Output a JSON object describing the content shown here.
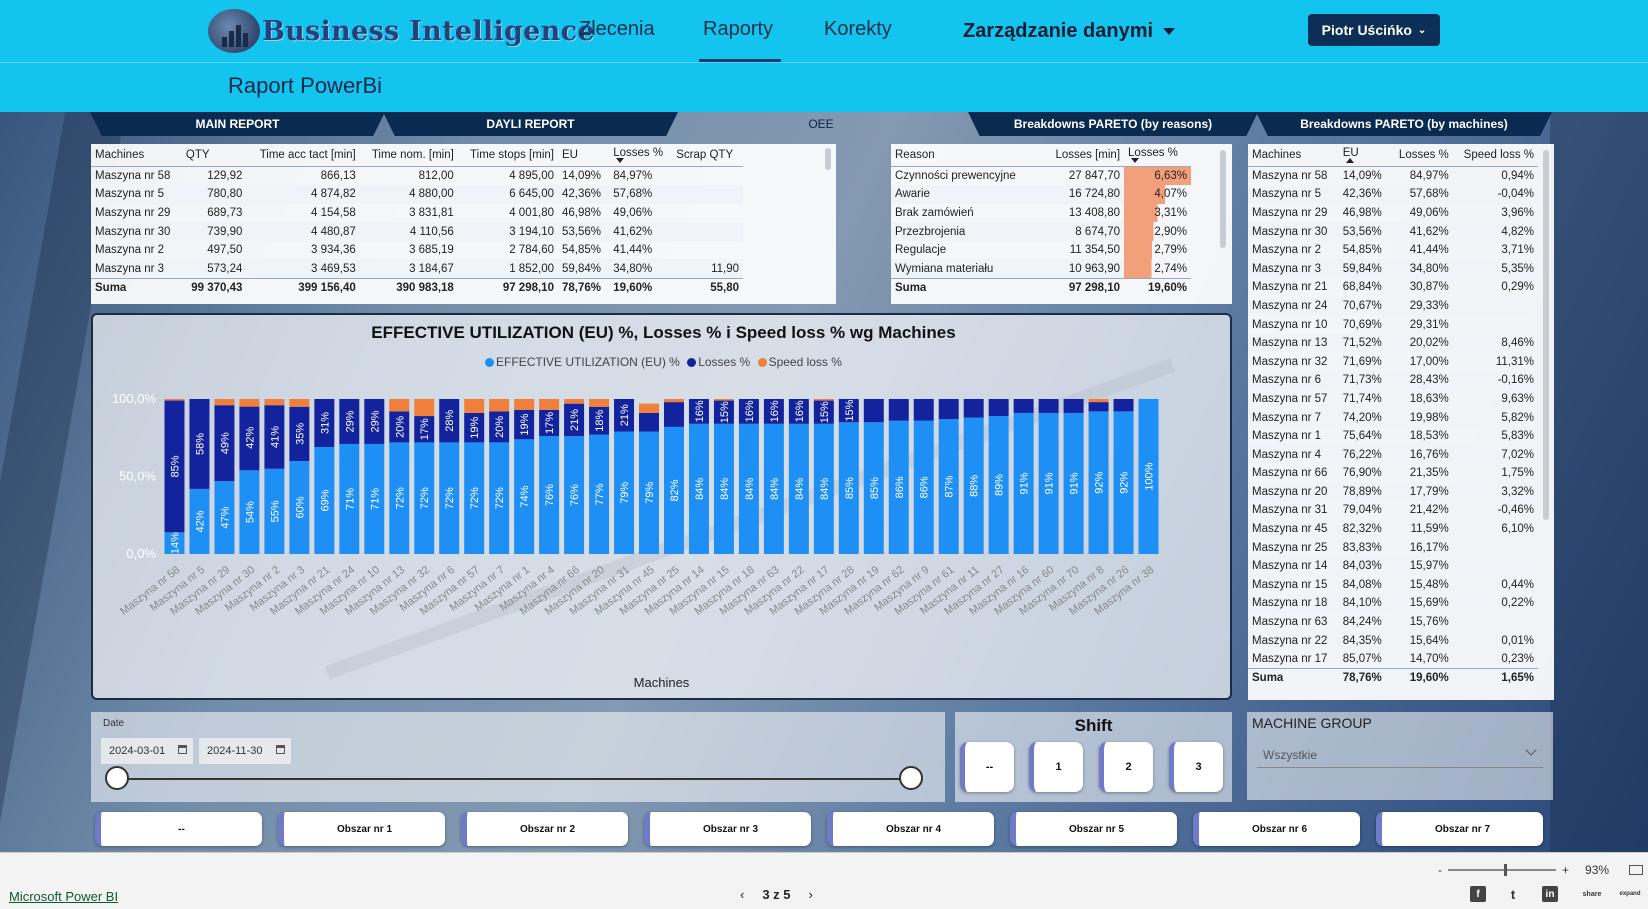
{
  "app": {
    "logo_text": "Business Intelligence",
    "nav": [
      "Zlecenia",
      "Raporty",
      "Korekty"
    ],
    "nav_active": "Raporty",
    "data_menu": "Zarządzanie danymi",
    "user": "Piotr Uścińko"
  },
  "page_title": "Raport PowerBi",
  "tabs": [
    "MAIN REPORT",
    "DAYLI REPORT",
    "OEE",
    "Breakdowns PARETO (by reasons)",
    "Breakdowns PARETO (by machines)"
  ],
  "main_table": {
    "headers": [
      "Machines",
      "QTY",
      "Time acc tact [min]",
      "Time nom. [min]",
      "Time stops [min]",
      "EU",
      "Losses %",
      "Scrap QTY"
    ],
    "rows": [
      [
        "Maszyna nr 58",
        "129,92",
        "866,13",
        "812,00",
        "4 895,00",
        "14,09%",
        "84,97%",
        ""
      ],
      [
        "Maszyna nr 5",
        "780,80",
        "4 874,82",
        "4 880,00",
        "6 645,00",
        "42,36%",
        "57,68%",
        ""
      ],
      [
        "Maszyna nr 29",
        "689,73",
        "4 154,58",
        "3 831,81",
        "4 001,80",
        "46,98%",
        "49,06%",
        ""
      ],
      [
        "Maszyna nr 30",
        "739,90",
        "4 480,87",
        "4 110,56",
        "3 194,10",
        "53,56%",
        "41,62%",
        ""
      ],
      [
        "Maszyna nr 2",
        "497,50",
        "3 934,36",
        "3 685,19",
        "2 784,60",
        "54,85%",
        "41,44%",
        ""
      ],
      [
        "Maszyna nr 3",
        "573,24",
        "3 469,53",
        "3 184,67",
        "1 852,00",
        "59,84%",
        "34,80%",
        "11,90"
      ]
    ],
    "sum": [
      "Suma",
      "99 370,43",
      "399 156,40",
      "390 983,18",
      "97 298,10",
      "78,76%",
      "19,60%",
      "55,80"
    ]
  },
  "reason_table": {
    "headers": [
      "Reason",
      "Losses [min]",
      "Losses %"
    ],
    "rows": [
      [
        "Czynności prewencyjne",
        "27 847,70",
        "6,63%"
      ],
      [
        "Awarie",
        "16 724,80",
        "4,07%"
      ],
      [
        "Brak zamówień",
        "13 408,80",
        "3,31%"
      ],
      [
        "Przezbrojenia",
        "8 674,70",
        "2,90%"
      ],
      [
        "Regulacje",
        "11 354,50",
        "2,79%"
      ],
      [
        "Wymiana materiału",
        "10 963,90",
        "2,74%"
      ]
    ],
    "bar_values": [
      6.63,
      4.07,
      3.31,
      2.9,
      2.79,
      2.74
    ],
    "sum": [
      "Suma",
      "97 298,10",
      "19,60%"
    ]
  },
  "machine_table": {
    "headers": [
      "Machines",
      "EU",
      "Losses %",
      "Speed loss %"
    ],
    "rows": [
      [
        "Maszyna nr 58",
        "14,09%",
        "84,97%",
        "0,94%"
      ],
      [
        "Maszyna nr 5",
        "42,36%",
        "57,68%",
        "-0,04%"
      ],
      [
        "Maszyna nr 29",
        "46,98%",
        "49,06%",
        "3,96%"
      ],
      [
        "Maszyna nr 30",
        "53,56%",
        "41,62%",
        "4,82%"
      ],
      [
        "Maszyna nr 2",
        "54,85%",
        "41,44%",
        "3,71%"
      ],
      [
        "Maszyna nr 3",
        "59,84%",
        "34,80%",
        "5,35%"
      ],
      [
        "Maszyna nr 21",
        "68,84%",
        "30,87%",
        "0,29%"
      ],
      [
        "Maszyna nr 24",
        "70,67%",
        "29,33%",
        ""
      ],
      [
        "Maszyna nr 10",
        "70,69%",
        "29,31%",
        ""
      ],
      [
        "Maszyna nr 13",
        "71,52%",
        "20,02%",
        "8,46%"
      ],
      [
        "Maszyna nr 32",
        "71,69%",
        "17,00%",
        "11,31%"
      ],
      [
        "Maszyna nr 6",
        "71,73%",
        "28,43%",
        "-0,16%"
      ],
      [
        "Maszyna nr 57",
        "71,74%",
        "18,63%",
        "9,63%"
      ],
      [
        "Maszyna nr 7",
        "74,20%",
        "19,98%",
        "5,82%"
      ],
      [
        "Maszyna nr 1",
        "75,64%",
        "18,53%",
        "5,83%"
      ],
      [
        "Maszyna nr 4",
        "76,22%",
        "16,76%",
        "7,02%"
      ],
      [
        "Maszyna nr 66",
        "76,90%",
        "21,35%",
        "1,75%"
      ],
      [
        "Maszyna nr 20",
        "78,89%",
        "17,79%",
        "3,32%"
      ],
      [
        "Maszyna nr 31",
        "79,04%",
        "21,42%",
        "-0,46%"
      ],
      [
        "Maszyna nr 45",
        "82,32%",
        "11,59%",
        "6,10%"
      ],
      [
        "Maszyna nr 25",
        "83,83%",
        "16,17%",
        ""
      ],
      [
        "Maszyna nr 14",
        "84,03%",
        "15,97%",
        ""
      ],
      [
        "Maszyna nr 15",
        "84,08%",
        "15,48%",
        "0,44%"
      ],
      [
        "Maszyna nr 18",
        "84,10%",
        "15,69%",
        "0,22%"
      ],
      [
        "Maszyna nr 63",
        "84,24%",
        "15,76%",
        ""
      ],
      [
        "Maszyna nr 22",
        "84,35%",
        "15,64%",
        "0,01%"
      ],
      [
        "Maszyna nr 17",
        "85,07%",
        "14,70%",
        "0,23%"
      ]
    ],
    "sum": [
      "Suma",
      "78,76%",
      "19,60%",
      "1,65%"
    ]
  },
  "chart_data": {
    "type": "bar",
    "stacked": true,
    "title": "EFFECTIVE UTILIZATION (EU) %, Losses % i Speed loss % wg Machines",
    "xlabel": "Machines",
    "ylabel": "",
    "ylim": [
      0,
      100
    ],
    "yticks": [
      "0,0%",
      "50,0%",
      "100,0%"
    ],
    "legend_position": "top",
    "categories": [
      "Maszyna nr 58",
      "Maszyna nr 5",
      "Maszyna nr 29",
      "Maszyna nr 30",
      "Maszyna nr 2",
      "Maszyna nr 3",
      "Maszyna nr 21",
      "Maszyna nr 24",
      "Maszyna nr 10",
      "Maszyna nr 13",
      "Maszyna nr 32",
      "Maszyna nr 6",
      "Maszyna nr 57",
      "Maszyna nr 7",
      "Maszyna nr 1",
      "Maszyna nr 4",
      "Maszyna nr 66",
      "Maszyna nr 20",
      "Maszyna nr 31",
      "Maszyna nr 45",
      "Maszyna nr 25",
      "Maszyna nr 14",
      "Maszyna nr 15",
      "Maszyna nr 18",
      "Maszyna nr 63",
      "Maszyna nr 22",
      "Maszyna nr 17",
      "Maszyna nr 28",
      "Maszyna nr 19",
      "Maszyna nr 62",
      "Maszyna nr 9",
      "Maszyna nr 61",
      "Maszyna nr 11",
      "Maszyna nr 27",
      "Maszyna nr 16",
      "Maszyna nr 60",
      "Maszyna nr 70",
      "Maszyna nr 8",
      "Maszyna nr 26",
      "Maszyna nr 38"
    ],
    "series": [
      {
        "name": "EFFECTIVE UTILIZATION (EU) %",
        "color": "#1e8ff5",
        "values": [
          14,
          42,
          47,
          54,
          55,
          60,
          69,
          71,
          71,
          72,
          72,
          72,
          72,
          72,
          74,
          76,
          76,
          77,
          79,
          79,
          82,
          84,
          84,
          84,
          84,
          84,
          84,
          85,
          85,
          86,
          86,
          87,
          88,
          89,
          91,
          91,
          91,
          92,
          92,
          100
        ]
      },
      {
        "name": "Losses %",
        "color": "#13239e",
        "values": [
          85,
          58,
          49,
          42,
          41,
          35,
          31,
          29,
          29,
          20,
          17,
          28,
          19,
          20,
          19,
          17,
          21,
          18,
          21,
          12,
          16,
          16,
          15,
          16,
          16,
          16,
          15,
          15,
          15,
          14,
          14,
          13,
          12,
          11,
          9,
          9,
          9,
          6,
          8,
          0
        ]
      },
      {
        "name": "Speed loss %",
        "color": "#ef7f3a",
        "values": [
          1,
          0,
          4,
          5,
          4,
          5,
          0,
          0,
          0,
          8,
          11,
          0,
          9,
          8,
          7,
          7,
          3,
          5,
          0,
          6,
          2,
          0,
          1,
          0,
          0,
          0,
          1,
          0,
          0,
          0,
          0,
          0,
          0,
          0,
          0,
          0,
          0,
          2,
          0,
          0
        ]
      }
    ],
    "bar_labels": {
      "eu": [
        "14%",
        "42%",
        "47%",
        "54%",
        "55%",
        "60%",
        "69%",
        "71%",
        "71%",
        "72%",
        "72%",
        "72%",
        "72%",
        "72%",
        "74%",
        "76%",
        "76%",
        "77%",
        "79%",
        "79%",
        "82%",
        "84%",
        "84%",
        "84%",
        "84%",
        "84%",
        "84%",
        "85%",
        "85%",
        "86%",
        "86%",
        "87%",
        "88%",
        "89%",
        "91%",
        "91%",
        "91%",
        "92%",
        "92%",
        "100%"
      ],
      "losses": [
        "85%",
        "58%",
        "49%",
        "42%",
        "41%",
        "35%",
        "31%",
        "29%",
        "29%",
        "20%",
        "17%",
        "28%",
        "19%",
        "20%",
        "19%",
        "17%",
        "21%",
        "18%",
        "21%",
        "",
        "",
        "16%",
        "15%",
        "16%",
        "16%",
        "16%",
        "15%",
        "15%",
        "",
        "",
        "",
        "",
        "",
        "",
        "",
        "",
        "",
        "",
        "",
        ""
      ]
    }
  },
  "date_slicer": {
    "label": "Date",
    "from": "2024-03-01",
    "to": "2024-11-30"
  },
  "shift": {
    "title": "Shift",
    "options": [
      "--",
      "1",
      "2",
      "3"
    ]
  },
  "machine_group": {
    "title": "MACHINE GROUP",
    "value": "Wszystkie"
  },
  "areas": [
    "--",
    "Obszar nr 1",
    "Obszar nr 2",
    "Obszar nr 3",
    "Obszar nr 4",
    "Obszar nr 5",
    "Obszar nr 6",
    "Obszar nr 7"
  ],
  "footer": {
    "link": "Microsoft Power BI",
    "page": "3 z 5",
    "zoom": "93%",
    "zoom_minus": "-",
    "zoom_plus": "+",
    "prev": "‹",
    "next": "›"
  },
  "social": [
    "f",
    "t",
    "in",
    "share",
    "expand"
  ]
}
